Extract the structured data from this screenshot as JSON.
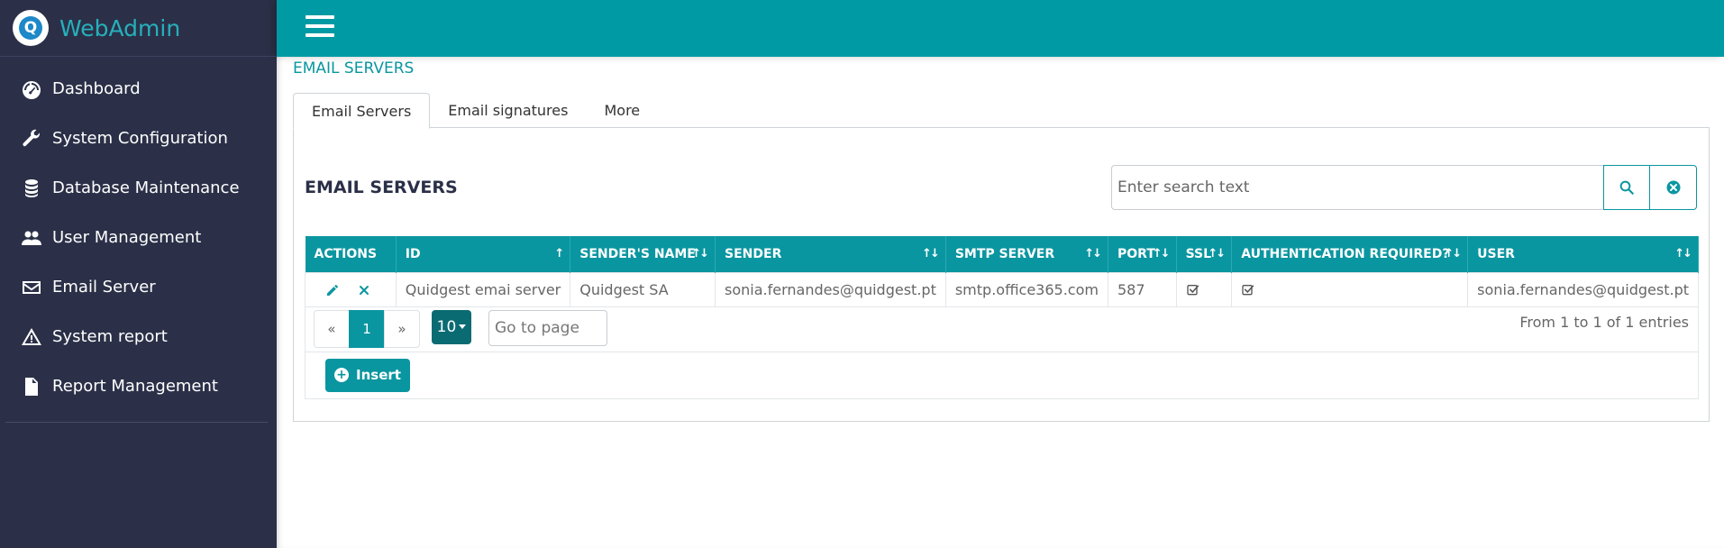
{
  "brand": {
    "name": "WebAdmin",
    "logo_letter": "Q"
  },
  "sidebar": {
    "items": [
      {
        "label": "Dashboard",
        "icon": "dashboard-icon"
      },
      {
        "label": "System Configuration",
        "icon": "wrench-icon"
      },
      {
        "label": "Database Maintenance",
        "icon": "database-icon"
      },
      {
        "label": "User Management",
        "icon": "users-icon"
      },
      {
        "label": "Email Server",
        "icon": "envelope-icon"
      },
      {
        "label": "System report",
        "icon": "warning-icon"
      },
      {
        "label": "Report Management",
        "icon": "file-icon"
      }
    ]
  },
  "page": {
    "heading": "EMAIL SERVERS"
  },
  "tabs": [
    {
      "label": "Email Servers",
      "active": true
    },
    {
      "label": "Email signatures",
      "active": false
    },
    {
      "label": "More",
      "active": false
    }
  ],
  "panel": {
    "title": "EMAIL SERVERS",
    "search": {
      "placeholder": "Enter search text"
    }
  },
  "table": {
    "columns": [
      {
        "label": "ACTIONS",
        "sort": ""
      },
      {
        "label": "ID",
        "sort": "↑"
      },
      {
        "label": "SENDER'S NAME",
        "sort": "↑↓"
      },
      {
        "label": "SENDER",
        "sort": "↑↓"
      },
      {
        "label": "SMTP SERVER",
        "sort": "↑↓"
      },
      {
        "label": "PORT",
        "sort": "↑↓"
      },
      {
        "label": "SSL",
        "sort": "↑↓"
      },
      {
        "label": "AUTHENTICATION REQUIRED?",
        "sort": "↑↓"
      },
      {
        "label": "USER",
        "sort": "↑↓"
      }
    ],
    "rows": [
      {
        "id": "Quidgest emai server",
        "sender_name": "Quidgest SA",
        "sender": "sonia.fernandes@quidgest.pt",
        "smtp_server": "smtp.office365.com",
        "port": "587",
        "ssl": true,
        "auth_required": true,
        "user": "sonia.fernandes@quidgest.pt"
      }
    ]
  },
  "pagination": {
    "prev": "«",
    "current": "1",
    "next": "»",
    "page_size": "10",
    "goto_placeholder": "Go to page",
    "entries_text": "From 1 to 1 of 1 entries"
  },
  "actions": {
    "insert_label": "Insert"
  },
  "colors": {
    "sidebar_bg": "#2b3048",
    "accent": "#009aa4",
    "brand_text": "#26b0bb"
  }
}
